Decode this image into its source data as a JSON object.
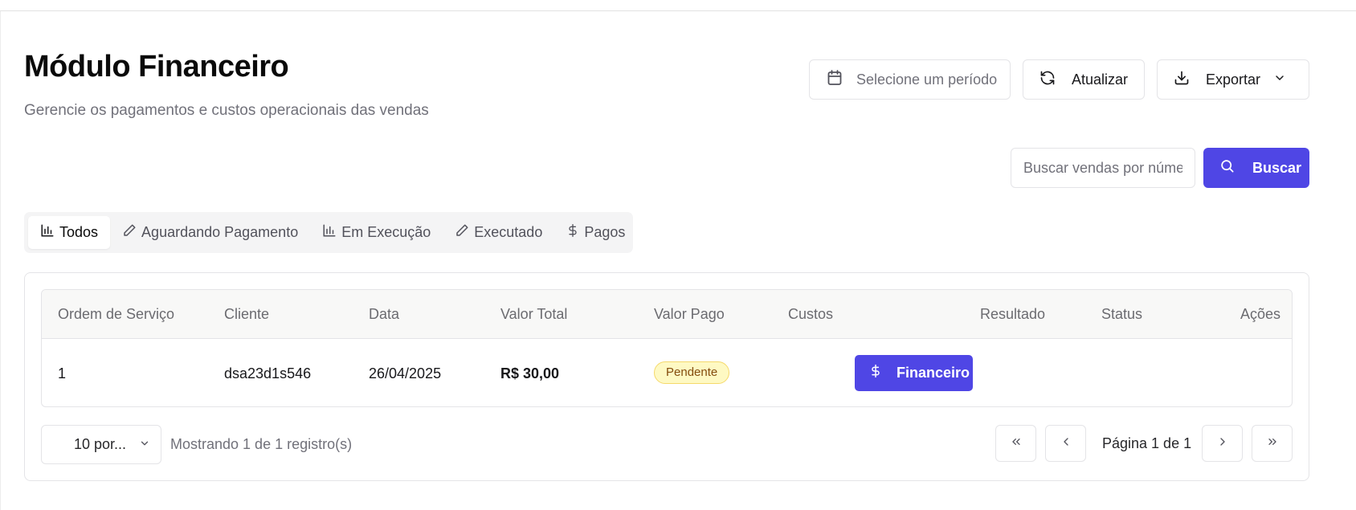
{
  "header": {
    "title": "Módulo Financeiro",
    "subtitle": "Gerencie os pagamentos e custos operacionais das vendas"
  },
  "toolbar": {
    "period_placeholder": "Selecione um período",
    "refresh_label": "Atualizar",
    "export_label": "Exportar"
  },
  "search": {
    "placeholder": "Buscar vendas por número",
    "button_label": "Buscar"
  },
  "tabs": [
    {
      "label": "Todos",
      "icon": "bar-chart-icon",
      "active": true
    },
    {
      "label": "Aguardando Pagamento",
      "icon": "pencil-icon",
      "active": false
    },
    {
      "label": "Em Execução",
      "icon": "bar-chart-icon",
      "active": false
    },
    {
      "label": "Executado",
      "icon": "pencil-icon",
      "active": false
    },
    {
      "label": "Pagos",
      "icon": "dollar-icon",
      "active": false
    }
  ],
  "table": {
    "columns": [
      "Ordem de Serviço",
      "Cliente",
      "Data",
      "Valor Total",
      "Valor Pago",
      "Custos",
      "Resultado",
      "Status",
      "Ações"
    ],
    "rows": [
      {
        "ordem": "1",
        "cliente": "dsa23d1s546",
        "data": "26/04/2025",
        "valor_total": "R$ 30,00",
        "valor_pago": "Pendente",
        "custos_button": "Financeiro",
        "resultado": "",
        "status": "",
        "acoes": ""
      }
    ]
  },
  "pagination": {
    "rows_per_page": "10 por...",
    "showing": "Mostrando 1 de 1 registro(s)",
    "page_info": "Página 1 de 1"
  },
  "colors": {
    "primary": "#4f46e5",
    "badge_bg": "#fef9c3",
    "badge_text": "#854d0e"
  }
}
